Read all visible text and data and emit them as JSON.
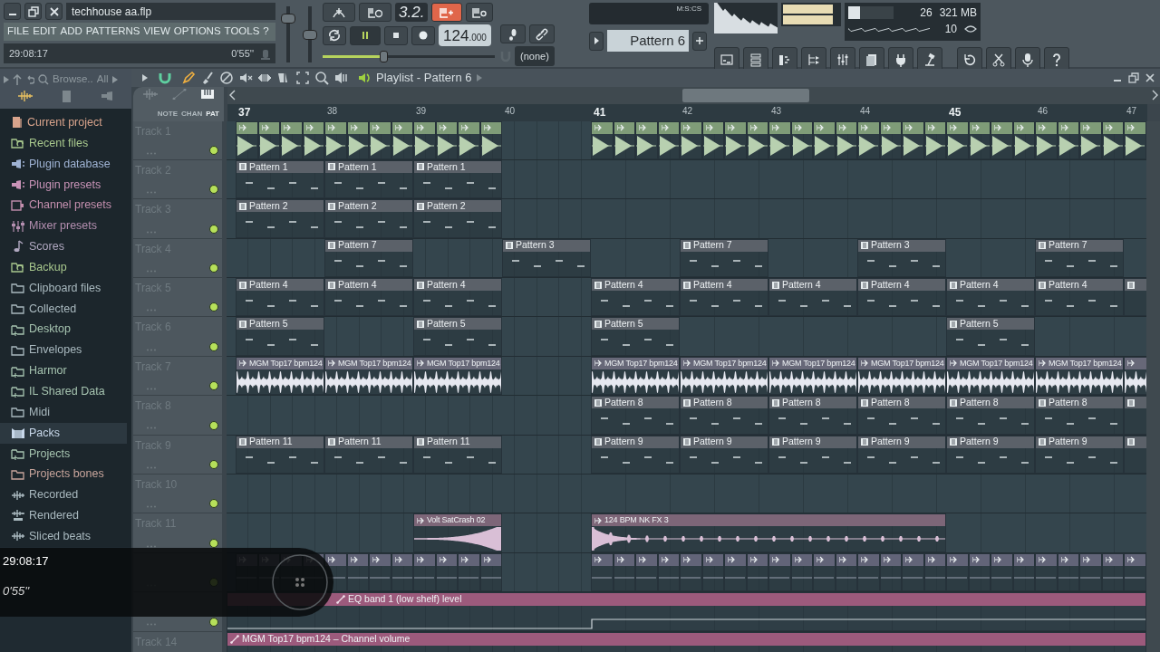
{
  "window": {
    "title": "techhouse aa.flp"
  },
  "menu": [
    "FILE",
    "EDIT",
    "ADD",
    "PATTERNS",
    "VIEW",
    "OPTIONS",
    "TOOLS",
    "?"
  ],
  "hint_bar": {
    "left": "29:08:17",
    "right": "0'55''"
  },
  "master_volume": {
    "level": 0.85
  },
  "master_pitch": {
    "level": 0.5
  },
  "transport": {
    "display": "3.2.",
    "step_edit": true,
    "playing": true,
    "recording": false,
    "tempo": "124",
    "tempo_fraction": ".000",
    "position": {
      "level": 0.35
    },
    "snap": "(none)"
  },
  "time_display": {
    "format": "M:S:CS"
  },
  "pattern_selector": {
    "label": "Pattern 6"
  },
  "monitor": {
    "cpu": "26",
    "memory": "321 MB",
    "polyphony": "10",
    "cpu_load": {
      "level": 0.26
    }
  },
  "browser": {
    "label": "Browse..",
    "filter": "All",
    "items": [
      {
        "label": "Current project",
        "kind": "project",
        "color": "#d9a48c",
        "selected": false
      },
      {
        "label": "Recent files",
        "kind": "recent",
        "color": "#a9c98e",
        "selected": false
      },
      {
        "label": "Plugin database",
        "kind": "plugin",
        "color": "#9fb3d4",
        "selected": false
      },
      {
        "label": "Plugin presets",
        "kind": "plugin",
        "color": "#c893b7",
        "selected": false
      },
      {
        "label": "Channel presets",
        "kind": "channel",
        "color": "#c48fae",
        "selected": false
      },
      {
        "label": "Mixer presets",
        "kind": "mixer",
        "color": "#b48fb0",
        "selected": false
      },
      {
        "label": "Scores",
        "kind": "score",
        "color": "#b0a8c0",
        "selected": false
      },
      {
        "label": "Backup",
        "kind": "recent",
        "color": "#a9c98e",
        "selected": false
      },
      {
        "label": "Clipboard files",
        "kind": "folder",
        "color": "#a9b9bf",
        "selected": false
      },
      {
        "label": "Collected",
        "kind": "folder",
        "color": "#a9b9bf",
        "selected": false
      },
      {
        "label": "Desktop",
        "kind": "folder-link",
        "color": "#a6c4b0",
        "selected": false
      },
      {
        "label": "Envelopes",
        "kind": "folder",
        "color": "#a9b9bf",
        "selected": false
      },
      {
        "label": "Harmor",
        "kind": "folder-link",
        "color": "#a6c4b0",
        "selected": false
      },
      {
        "label": "IL Shared Data",
        "kind": "folder-link",
        "color": "#a6c4b0",
        "selected": false
      },
      {
        "label": "Midi",
        "kind": "folder",
        "color": "#a9b9bf",
        "selected": false
      },
      {
        "label": "Packs",
        "kind": "pack",
        "color": "#c8d8ea",
        "selected": true
      },
      {
        "label": "Projects",
        "kind": "folder-link",
        "color": "#a6c4b0",
        "selected": false
      },
      {
        "label": "Projects bones",
        "kind": "folder",
        "color": "#c8a59c",
        "selected": false
      },
      {
        "label": "Recorded",
        "kind": "wave",
        "color": "#a9b9bf",
        "selected": false
      },
      {
        "label": "Rendered",
        "kind": "rendered",
        "color": "#a9b9bf",
        "selected": false
      },
      {
        "label": "Sliced beats",
        "kind": "wave",
        "color": "#a9b9bf",
        "selected": false
      }
    ]
  },
  "playlist": {
    "title": "Playlist - Pattern 6",
    "header_tabs": [
      {
        "label": "NOTE",
        "selected": false
      },
      {
        "label": "CHAN",
        "selected": false
      },
      {
        "label": "PAT",
        "selected": true
      }
    ],
    "bars": [
      {
        "label": "37",
        "major": true
      },
      {
        "label": "38",
        "major": false
      },
      {
        "label": "39",
        "major": false
      },
      {
        "label": "40",
        "major": false
      },
      {
        "label": "41",
        "major": true
      },
      {
        "label": "42",
        "major": false
      },
      {
        "label": "43",
        "major": false
      },
      {
        "label": "44",
        "major": false
      },
      {
        "label": "45",
        "major": true
      },
      {
        "label": "46",
        "major": false
      },
      {
        "label": "47",
        "major": false
      }
    ],
    "tracks": [
      {
        "name": "Track 1",
        "enabled": true,
        "slots": [
          {
            "kind": "kick"
          },
          {
            "kind": "kick"
          },
          {
            "kind": "kick"
          },
          {
            "kind": "gap"
          },
          {
            "kind": "kick"
          },
          {
            "kind": "kick"
          },
          {
            "kind": "kick"
          },
          {
            "kind": "kick"
          },
          {
            "kind": "kick"
          },
          {
            "kind": "kick"
          },
          {
            "kind": "kick"
          }
        ]
      },
      {
        "name": "Track 2",
        "enabled": true,
        "slots": [
          {
            "kind": "pattern",
            "label": "Pattern 1"
          },
          {
            "kind": "pattern",
            "label": "Pattern 1"
          },
          {
            "kind": "pattern",
            "label": "Pattern 1"
          }
        ]
      },
      {
        "name": "Track 3",
        "enabled": true,
        "slots": [
          {
            "kind": "pattern",
            "label": "Pattern 2"
          },
          {
            "kind": "pattern",
            "label": "Pattern 2"
          },
          {
            "kind": "pattern",
            "label": "Pattern 2"
          }
        ]
      },
      {
        "name": "Track 4",
        "enabled": true,
        "slots": [
          {
            "kind": "gap"
          },
          {
            "kind": "pattern",
            "label": "Pattern 7"
          },
          {
            "kind": "gap"
          },
          {
            "kind": "pattern",
            "label": "Pattern 3"
          },
          {
            "kind": "gap"
          },
          {
            "kind": "pattern",
            "label": "Pattern 7"
          },
          {
            "kind": "gap"
          },
          {
            "kind": "pattern",
            "label": "Pattern 3"
          },
          {
            "kind": "gap"
          },
          {
            "kind": "pattern",
            "label": "Pattern 7"
          }
        ]
      },
      {
        "name": "Track 5",
        "enabled": true,
        "slots": [
          {
            "kind": "pattern",
            "label": "Pattern 4"
          },
          {
            "kind": "pattern",
            "label": "Pattern 4"
          },
          {
            "kind": "pattern",
            "label": "Pattern 4"
          },
          {
            "kind": "gap"
          },
          {
            "kind": "pattern",
            "label": "Pattern 4"
          },
          {
            "kind": "pattern",
            "label": "Pattern 4"
          },
          {
            "kind": "pattern",
            "label": "Pattern 4"
          },
          {
            "kind": "pattern",
            "label": "Pattern 4"
          },
          {
            "kind": "pattern",
            "label": "Pattern 4"
          },
          {
            "kind": "pattern",
            "label": "Pattern 4"
          },
          {
            "kind": "pattern"
          }
        ]
      },
      {
        "name": "Track 6",
        "enabled": true,
        "slots": [
          {
            "kind": "pattern",
            "label": "Pattern 5"
          },
          {
            "kind": "gap"
          },
          {
            "kind": "pattern",
            "label": "Pattern 5"
          },
          {
            "kind": "gap"
          },
          {
            "kind": "pattern",
            "label": "Pattern 5"
          },
          {
            "kind": "gap"
          },
          {
            "kind": "gap"
          },
          {
            "kind": "gap"
          },
          {
            "kind": "pattern",
            "label": "Pattern 5"
          }
        ]
      },
      {
        "name": "Track 7",
        "enabled": true,
        "slots": [
          {
            "kind": "loop",
            "label": "MGM Top17 bpm124"
          },
          {
            "kind": "loop",
            "label": "MGM Top17 bpm124"
          },
          {
            "kind": "loop",
            "label": "MGM Top17 bpm124"
          },
          {
            "kind": "gap"
          },
          {
            "kind": "loop",
            "label": "MGM Top17 bpm124"
          },
          {
            "kind": "loop",
            "label": "MGM Top17 bpm124"
          },
          {
            "kind": "loop",
            "label": "MGM Top17 bpm124"
          },
          {
            "kind": "loop",
            "label": "MGM Top17 bpm124"
          },
          {
            "kind": "loop",
            "label": "MGM Top17 bpm124"
          },
          {
            "kind": "loop",
            "label": "MGM Top17 bpm124"
          },
          {
            "kind": "loop"
          }
        ]
      },
      {
        "name": "Track 8",
        "enabled": true,
        "slots": [
          {
            "kind": "gap"
          },
          {
            "kind": "gap"
          },
          {
            "kind": "gap"
          },
          {
            "kind": "gap"
          },
          {
            "kind": "pattern",
            "label": "Pattern 8"
          },
          {
            "kind": "pattern",
            "label": "Pattern 8"
          },
          {
            "kind": "pattern",
            "label": "Pattern 8"
          },
          {
            "kind": "pattern",
            "label": "Pattern 8"
          },
          {
            "kind": "pattern",
            "label": "Pattern 8"
          },
          {
            "kind": "pattern",
            "label": "Pattern 8"
          },
          {
            "kind": "pattern"
          }
        ]
      },
      {
        "name": "Track 9",
        "enabled": true,
        "slots": [
          {
            "kind": "pattern",
            "label": "Pattern 11"
          },
          {
            "kind": "pattern",
            "label": "Pattern 11"
          },
          {
            "kind": "pattern",
            "label": "Pattern 11"
          },
          {
            "kind": "gap"
          },
          {
            "kind": "pattern",
            "label": "Pattern 9"
          },
          {
            "kind": "pattern",
            "label": "Pattern 9"
          },
          {
            "kind": "pattern",
            "label": "Pattern 9"
          },
          {
            "kind": "pattern",
            "label": "Pattern 9"
          },
          {
            "kind": "pattern",
            "label": "Pattern 9"
          },
          {
            "kind": "pattern",
            "label": "Pattern 9"
          },
          {
            "kind": "pattern"
          }
        ]
      },
      {
        "name": "Track 10",
        "enabled": true
      },
      {
        "name": "Track 11",
        "enabled": true,
        "slots": [
          {
            "kind": "gap"
          },
          {
            "kind": "gap"
          },
          {
            "kind": "riser",
            "label": "Volt SatCrash 02"
          },
          {
            "kind": "gap"
          },
          {
            "kind": "fx",
            "label": "124 BPM NK FX 3"
          },
          {
            "kind": "continued"
          },
          {
            "kind": "continued"
          },
          {
            "kind": "continued"
          }
        ]
      },
      {
        "enabled": true,
        "slots": [
          {
            "kind": "hits"
          },
          {
            "kind": "hits"
          },
          {
            "kind": "hits"
          },
          {
            "kind": "gap"
          },
          {
            "kind": "hits"
          },
          {
            "kind": "hits"
          },
          {
            "kind": "hits"
          },
          {
            "kind": "hits"
          },
          {
            "kind": "hits"
          },
          {
            "kind": "hits"
          },
          {
            "kind": "hits"
          }
        ]
      },
      {
        "enabled": true,
        "automation": {
          "label": "EQ band 1 (low shelf) level",
          "partly_covered": true
        }
      },
      {
        "name": "Track 14",
        "automation": {
          "label": "MGM Top17 bpm124 – Channel volume",
          "partly_covered": false
        }
      }
    ]
  },
  "video_overlay": {
    "time": "29:08:17",
    "duration": "0'55''"
  }
}
